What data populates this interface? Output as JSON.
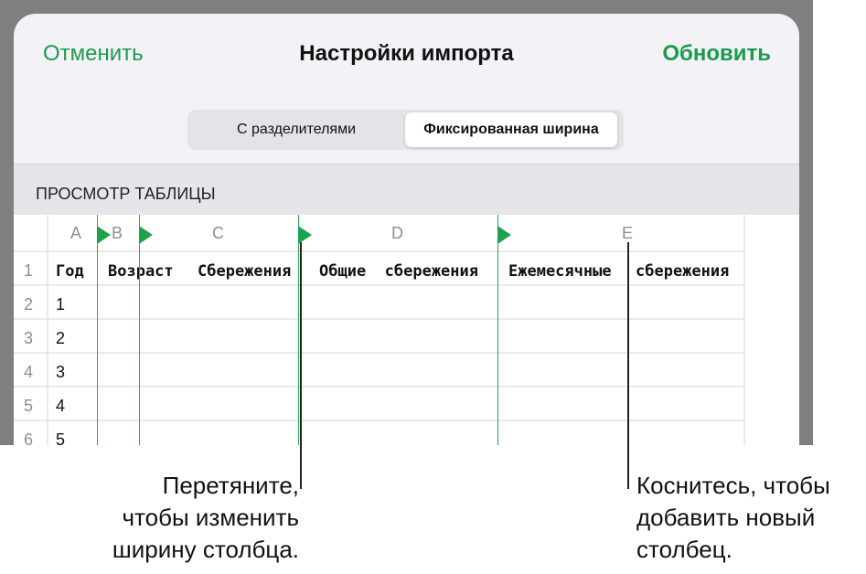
{
  "header": {
    "cancel": "Отменить",
    "title": "Настройки импорта",
    "update": "Обновить"
  },
  "segmented": {
    "option1": "С разделителями",
    "option2": "Фиксированная ширина"
  },
  "section": {
    "label": "ПРОСМОТР ТАБЛИЦЫ"
  },
  "columns": [
    "A",
    "B",
    "C",
    "D",
    "E"
  ],
  "rows": [
    "1",
    "2",
    "3",
    "4",
    "5",
    "6"
  ],
  "header_row": "Год  Возраст  Сбережения  Общие  сбережения  Ежемесячные  сбережения",
  "header_parts": {
    "p1": "Год",
    "p2": "Возраст",
    "p3": "Сбережения",
    "p4": "Общие  сбережения",
    "p5": "Ежемесячные",
    "p6": "сбережения"
  },
  "values": [
    "1",
    "2",
    "3",
    "4",
    "5"
  ],
  "callouts": {
    "drag": {
      "line1": "Перетяните,",
      "line2": "чтобы изменить",
      "line3": "ширину столбца."
    },
    "tap": {
      "line1": "Коснитесь, чтобы",
      "line2": "добавить новый",
      "line3": "столбец."
    }
  },
  "colors": {
    "accent": "#1b9b4e",
    "marker": "#1ea14f"
  }
}
